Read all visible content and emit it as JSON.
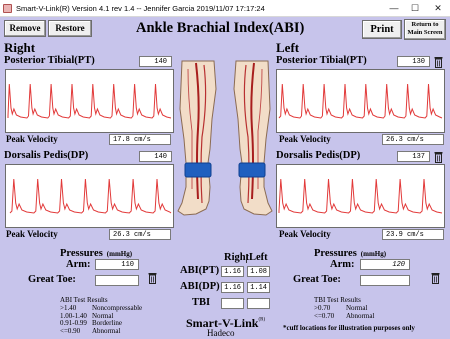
{
  "window": {
    "title": "Smart-V-Link(R)  Version 4.1 rev 1.4   -- Jennifer Garcia  2019/11/07   17:17:24"
  },
  "toolbar": {
    "remove_label": "Remove",
    "restore_label": "Restore",
    "print_label": "Print",
    "return_label_line1": "Return to",
    "return_label_line2": "Main Screen"
  },
  "page": {
    "title": "Ankle Brachial Index(ABI)"
  },
  "right": {
    "heading": "Right",
    "pt_label": "Posterior Tibial(PT)",
    "pt_value": "140",
    "pt_velocity_label": "Peak Velocity",
    "pt_velocity": "17.8 cm/s",
    "dp_label": "Dorsalis Pedis(DP)",
    "dp_value": "140",
    "dp_velocity_label": "Peak Velocity",
    "dp_velocity": "26.3 cm/s",
    "pressures_label": "Pressures",
    "pressures_unit": "(mmHg)",
    "arm_label": "Arm:",
    "arm_value": "110",
    "toe_label": "Great Toe:",
    "toe_value": ""
  },
  "left": {
    "heading": "Left",
    "pt_label": "Posterior Tibial(PT)",
    "pt_value": "130",
    "pt_velocity_label": "Peak Velocity",
    "pt_velocity": "26.3 cm/s",
    "dp_label": "Dorsalis Pedis(DP)",
    "dp_value": "137",
    "dp_velocity_label": "Peak Velocity",
    "dp_velocity": "23.9 cm/s",
    "pressures_label": "Pressures",
    "pressures_unit": "(mmHg)",
    "arm_label": "Arm:",
    "arm_value": "120",
    "toe_label": "Great Toe:",
    "toe_value": ""
  },
  "results": {
    "col_right": "Right",
    "col_left": "Left",
    "abi_pt_label": "ABI(PT)",
    "abi_pt_right": "1.16",
    "abi_pt_left": "1.08",
    "abi_dp_label": "ABI(DP)",
    "abi_dp_right": "1.16",
    "abi_dp_left": "1.14",
    "tbi_label": "TBI",
    "tbi_right": "",
    "tbi_left": ""
  },
  "abi_legend": {
    "title": "ABI Test Results",
    "rows": [
      {
        "range": ">1.40",
        "meaning": "Noncompressable"
      },
      {
        "range": "1.00-1.40",
        "meaning": "Normal"
      },
      {
        "range": "0.91-0.99",
        "meaning": "Borderline"
      },
      {
        "range": "<=0.90",
        "meaning": "Abnormal"
      }
    ]
  },
  "tbi_legend": {
    "title": "TBI Test Results",
    "rows": [
      {
        "range": ">0.70",
        "meaning": "Normal"
      },
      {
        "range": "<=0.70",
        "meaning": "Abnormal"
      }
    ],
    "note": "*cuff locations for illustration purposes only"
  },
  "brand": {
    "name": "Smart-V-Link",
    "mark": "(R)",
    "sub": "Hadeco"
  },
  "colors": {
    "background": "#c7c4eb",
    "waveform": "#e23a3a",
    "cuff": "#1f5fbf",
    "vessel": "#a81e1e"
  },
  "icons": {
    "trash": "trash-icon",
    "legs": "legs-illustration",
    "app": "app-icon"
  }
}
